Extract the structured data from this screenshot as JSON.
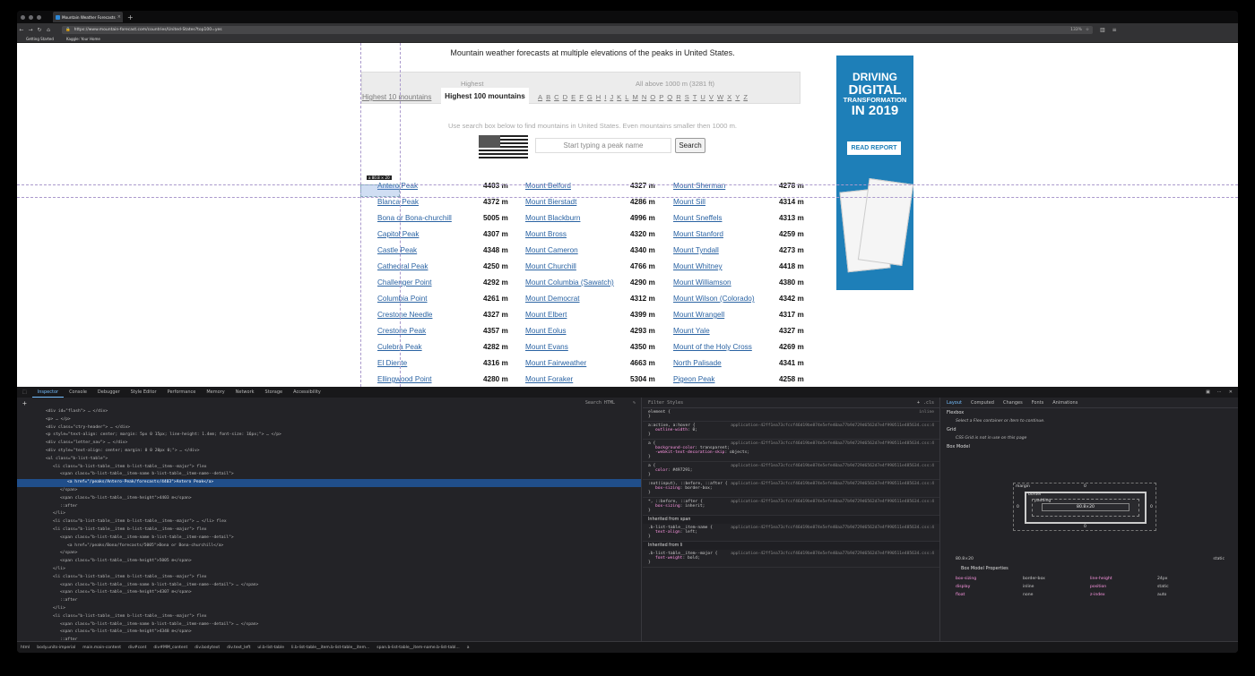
{
  "browser": {
    "tab_title": "Mountain Weather Forecasts",
    "url": "https://www.mountain-forecast.com/countries/United-States?top100=yes",
    "zoom": "133%",
    "bookmarks": [
      "Getting Started",
      "Kaggle: Your Home"
    ]
  },
  "page": {
    "heading": "Mountain weather forecasts at multiple elevations of the peaks in United States.",
    "nav_label_highest": "Highest",
    "nav_label_all": "All above 1000 m (3281 ft)",
    "nav_highest10": "Highest 10 mountains",
    "nav_highest100": "Highest 100 mountains",
    "letters": [
      "A",
      "B",
      "C",
      "D",
      "E",
      "F",
      "G",
      "H",
      "I",
      "J",
      "K",
      "L",
      "M",
      "N",
      "O",
      "P",
      "Q",
      "R",
      "S",
      "T",
      "U",
      "V",
      "W",
      "X",
      "Y",
      "Z"
    ],
    "search_hint": "Use search box below to find mountains in United States. Even mountains smaller then 1000 m.",
    "search_placeholder": "Start typing a peak name",
    "search_button": "Search",
    "highlight_tooltip": "a 80.8 × 20",
    "peaks": [
      [
        [
          "Antero Peak",
          "4403 m"
        ],
        [
          "Mount Belford",
          "4327 m"
        ],
        [
          "Mount Sherman",
          "4278 m"
        ]
      ],
      [
        [
          "Blanca Peak",
          "4372 m"
        ],
        [
          "Mount Bierstadt",
          "4286 m"
        ],
        [
          "Mount Sill",
          "4314 m"
        ]
      ],
      [
        [
          "Bona or Bona-churchill",
          "5005 m"
        ],
        [
          "Mount Blackburn",
          "4996 m"
        ],
        [
          "Mount Sneffels",
          "4313 m"
        ]
      ],
      [
        [
          "Capitol Peak",
          "4307 m"
        ],
        [
          "Mount Bross",
          "4320 m"
        ],
        [
          "Mount Stanford",
          "4259 m"
        ]
      ],
      [
        [
          "Castle Peak",
          "4348 m"
        ],
        [
          "Mount Cameron",
          "4340 m"
        ],
        [
          "Mount Tyndall",
          "4273 m"
        ]
      ],
      [
        [
          "Cathedral Peak",
          "4250 m"
        ],
        [
          "Mount Churchill",
          "4766 m"
        ],
        [
          "Mount Whitney",
          "4418 m"
        ]
      ],
      [
        [
          "Challenger Point",
          "4292 m"
        ],
        [
          "Mount Columbia (Sawatch)",
          "4290 m"
        ],
        [
          "Mount Williamson",
          "4380 m"
        ]
      ],
      [
        [
          "Columbia Point",
          "4261 m"
        ],
        [
          "Mount Democrat",
          "4312 m"
        ],
        [
          "Mount Wilson (Colorado)",
          "4342 m"
        ]
      ],
      [
        [
          "Crestone Needle",
          "4327 m"
        ],
        [
          "Mount Elbert",
          "4399 m"
        ],
        [
          "Mount Wrangell",
          "4317 m"
        ]
      ],
      [
        [
          "Crestone Peak",
          "4357 m"
        ],
        [
          "Mount Eolus",
          "4293 m"
        ],
        [
          "Mount Yale",
          "4327 m"
        ]
      ],
      [
        [
          "Culebra Peak",
          "4282 m"
        ],
        [
          "Mount Evans",
          "4350 m"
        ],
        [
          "Mount of the Holy Cross",
          "4269 m"
        ]
      ],
      [
        [
          "El Diente",
          "4316 m"
        ],
        [
          "Mount Fairweather",
          "4663 m"
        ],
        [
          "North Palisade",
          "4341 m"
        ]
      ],
      [
        [
          "Ellingwood Point",
          "4280 m"
        ],
        [
          "Mount Foraker",
          "5304 m"
        ],
        [
          "Pigeon Peak",
          "4258 m"
        ]
      ]
    ]
  },
  "ad": {
    "line1": "DRIVING",
    "line2": "DIGITAL",
    "line3": "TRANSFORMATION",
    "line4": "IN 2019",
    "button": "READ REPORT",
    "color": "#1e7fb8"
  },
  "devtools": {
    "tabs": [
      "Inspector",
      "Console",
      "Debugger",
      "Style Editor",
      "Performance",
      "Memory",
      "Network",
      "Storage",
      "Accessibility"
    ],
    "search_placeholder": "Search HTML",
    "filter_placeholder": "Filter Styles",
    "pseudo": ".cls",
    "markup_lines": [
      "<div id=\"flash\"> … </div>",
      "<p> … </p>",
      "<div class=\"ctry-header\"> … </div>",
      "<p style=\"text-align: center; margin: 5px 0 15px; line-height: 1.4em; font-size: 16px;\"> … </p>",
      "<div class=\"letter_nav\"> … </div>",
      "<div style=\"text-align: center; margin: 0 0 20px 0;\"> … </div>",
      "<ul class=\"b-list-table\">",
      "<li class=\"b-list-table__item b-list-table__item--major\"> flex",
      "<span class=\"b-list-table__item-name b-list-table__item-name--detail\">",
      "<a href=\"/peaks/Antero-Peak/forecasts/4403\">Antero Peak</a>",
      "</span>",
      "<span class=\"b-list-table__item-height\">4403 m</span>",
      "::after",
      "</li>",
      "<li class=\"b-list-table__item b-list-table__item--major\"> … </li> flex",
      "<li class=\"b-list-table__item b-list-table__item--major\"> flex",
      "<span class=\"b-list-table__item-name b-list-table__item-name--detail\">",
      "<a href=\"/peaks/Bona/forecasts/5005\">Bona or Bona-churchill</a>",
      "</span>",
      "<span class=\"b-list-table__item-height\">5005 m</span>",
      "</li>",
      "<li class=\"b-list-table__item b-list-table__item--major\"> flex",
      "<span class=\"b-list-table__item-name b-list-table__item-name--detail\"> … </span>",
      "<span class=\"b-list-table__item-height\">4307 m</span>",
      "::after",
      "</li>",
      "<li class=\"b-list-table__item b-list-table__item--major\"> flex",
      "<span class=\"b-list-table__item-name b-list-table__item-name--detail\"> … </span>",
      "<span class=\"b-list-table__item-height\">4348 m</span>",
      "::after",
      "</li>",
      "<li class=\"b-list-table__item b-list-table__item--major\"> … </li> flex"
    ],
    "breadcrumbs": [
      "html",
      "body.units-imperial",
      "main.main-content",
      "div#cont",
      "div#MM_content",
      "div.bodytext",
      "div.text_left",
      "ul.b-list-table",
      "li.b-list-table__item.b-list-table__item...",
      "span.b-list-table__item-name.b-list-tabl...",
      "a"
    ],
    "rules": [
      {
        "sel": "element {",
        "src": "inline",
        "decls": []
      },
      {
        "sel": "a:active, a:hover {",
        "src": "application-42ff1ea73cfccf46d19be874e5efe40aa77b9d729d6562d7e4f990511e485634.css:4",
        "decls": [
          [
            "outline-width",
            "0;"
          ]
        ]
      },
      {
        "sel": "a {",
        "src": "application-42ff1ea73cfccf46d19be874e5efe40aa77b9d729d6562d7e4f990511e485634.css:4",
        "decls": [
          [
            "background-color",
            "transparent;"
          ],
          [
            "-webkit-text-decoration-skip",
            "objects;"
          ]
        ]
      },
      {
        "sel": "a {",
        "src": "application-42ff1ea73cfccf46d19be874e5efe40aa77b9d729d6562d7e4f990511e485634.css:4",
        "decls": [
          [
            "color",
            "#497291;"
          ]
        ]
      },
      {
        "sel": ":not(input), ::before, ::after {",
        "src": "application-42ff1ea73cfccf46d19be874e5efe40aa77b9d729d6562d7e4f990511e485634.css:4",
        "decls": [
          [
            "box-sizing",
            "border-box;"
          ]
        ]
      },
      {
        "sel": "*, ::before, ::after {",
        "src": "application-42ff1ea73cfccf46d19be874e5efe40aa77b9d729d6562d7e4f990511e485634.css:4",
        "decls": [
          [
            "box-sizing",
            "inherit;"
          ]
        ]
      }
    ],
    "inherited_span": "Inherited from span",
    "inherited_span_rule": {
      "sel": ".b-list-table__item-name {",
      "src": "application-42ff1ea73cfccf46d19be874e5efe40aa77b9d729d6562d7e4f990511e485634.css:4",
      "decls": [
        [
          "text-align",
          "left;"
        ]
      ]
    },
    "inherited_li": "Inherited from li",
    "inherited_li_rule": {
      "sel": ".b-list-table__item--major {",
      "src": "application-42ff1ea73cfccf46d19be874e5efe40aa77b9d729d6562d7e4f990511e485634.css:4",
      "decls": [
        [
          "font-weight",
          "bold;"
        ]
      ]
    },
    "layout_tabs": [
      "Layout",
      "Computed",
      "Changes",
      "Fonts",
      "Animations"
    ],
    "flexbox_title": "Flexbox",
    "flexbox_note": "Select a Flex container or item to continue.",
    "grid_title": "Grid",
    "grid_note": "CSS Grid is not in use on this page",
    "boxmodel_title": "Box Model",
    "bm_margin": "margin",
    "bm_border": "border",
    "bm_padding": "padding",
    "bm_content": "80.8×20",
    "bm_zero": "0",
    "bm_size": "80.8×20",
    "bm_position": "static",
    "bm_props_title": "Box Model Properties",
    "bm_props": [
      [
        "box-sizing",
        "border-box",
        "line-height",
        "24px"
      ],
      [
        "display",
        "inline",
        "position",
        "static"
      ],
      [
        "float",
        "none",
        "z-index",
        "auto"
      ]
    ]
  }
}
